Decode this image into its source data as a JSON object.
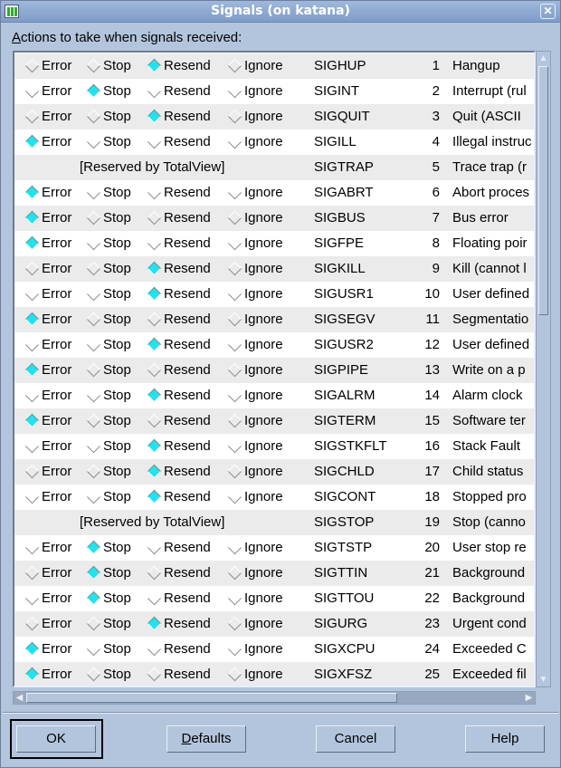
{
  "window": {
    "title": "Signals (on katana)",
    "close_icon": "close-icon"
  },
  "caption": {
    "accel": "A",
    "rest": "ctions to take when signals received:"
  },
  "action_labels": [
    "Error",
    "Stop",
    "Resend",
    "Ignore"
  ],
  "reserved_label": "[Reserved by TotalView]",
  "colors": {
    "selected": "#1ee4ef",
    "background": "#b3c5dd"
  },
  "signals": [
    {
      "name": "SIGHUP",
      "num": "1",
      "desc": "Hangup",
      "action": "Resend"
    },
    {
      "name": "SIGINT",
      "num": "2",
      "desc": "Interrupt (rul",
      "action": "Stop"
    },
    {
      "name": "SIGQUIT",
      "num": "3",
      "desc": "Quit (ASCII",
      "action": "Resend"
    },
    {
      "name": "SIGILL",
      "num": "4",
      "desc": "Illegal instruc",
      "action": "Error"
    },
    {
      "name": "SIGTRAP",
      "num": "5",
      "desc": "Trace trap (r",
      "action": "reserved"
    },
    {
      "name": "SIGABRT",
      "num": "6",
      "desc": "Abort proces",
      "action": "Error"
    },
    {
      "name": "SIGBUS",
      "num": "7",
      "desc": "Bus error",
      "action": "Error"
    },
    {
      "name": "SIGFPE",
      "num": "8",
      "desc": "Floating poir",
      "action": "Error"
    },
    {
      "name": "SIGKILL",
      "num": "9",
      "desc": "Kill (cannot l",
      "action": "Resend"
    },
    {
      "name": "SIGUSR1",
      "num": "10",
      "desc": "User defined",
      "action": "Resend"
    },
    {
      "name": "SIGSEGV",
      "num": "11",
      "desc": "Segmentatio",
      "action": "Error"
    },
    {
      "name": "SIGUSR2",
      "num": "12",
      "desc": "User defined",
      "action": "Resend"
    },
    {
      "name": "SIGPIPE",
      "num": "13",
      "desc": "Write on a p",
      "action": "Error"
    },
    {
      "name": "SIGALRM",
      "num": "14",
      "desc": "Alarm clock",
      "action": "Resend"
    },
    {
      "name": "SIGTERM",
      "num": "15",
      "desc": "Software ter",
      "action": "Error"
    },
    {
      "name": "SIGSTKFLT",
      "num": "16",
      "desc": "Stack Fault",
      "action": "Resend"
    },
    {
      "name": "SIGCHLD",
      "num": "17",
      "desc": "Child status",
      "action": "Resend"
    },
    {
      "name": "SIGCONT",
      "num": "18",
      "desc": "Stopped pro",
      "action": "Resend"
    },
    {
      "name": "SIGSTOP",
      "num": "19",
      "desc": "Stop (canno",
      "action": "reserved"
    },
    {
      "name": "SIGTSTP",
      "num": "20",
      "desc": "User stop re",
      "action": "Stop"
    },
    {
      "name": "SIGTTIN",
      "num": "21",
      "desc": "Background",
      "action": "Stop"
    },
    {
      "name": "SIGTTOU",
      "num": "22",
      "desc": "Background",
      "action": "Stop"
    },
    {
      "name": "SIGURG",
      "num": "23",
      "desc": "Urgent cond",
      "action": "Resend"
    },
    {
      "name": "SIGXCPU",
      "num": "24",
      "desc": "Exceeded C",
      "action": "Error"
    },
    {
      "name": "SIGXFSZ",
      "num": "25",
      "desc": "Exceeded fil",
      "action": "Error"
    }
  ],
  "buttons": {
    "ok": "OK",
    "defaults_accel": "D",
    "defaults_rest": "efaults",
    "cancel": "Cancel",
    "help": "Help"
  }
}
